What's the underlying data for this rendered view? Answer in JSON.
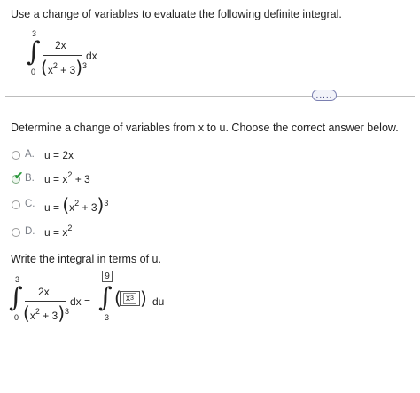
{
  "problem": {
    "instruction": "Use a change of variables to evaluate the following definite integral.",
    "integral": {
      "upper": "3",
      "lower": "0",
      "numerator": "2x",
      "denominator_base": "x",
      "denominator_inner_exp": "2",
      "denominator_plus": "+ 3",
      "denominator_outer_exp": "3",
      "differential": "dx"
    }
  },
  "more_button": {
    "label": "....."
  },
  "question1": {
    "prompt": "Determine a change of variables from x to u. Choose the correct answer below.",
    "options": [
      {
        "letter": "A.",
        "text": "u = 2x",
        "selected": false
      },
      {
        "letter": "B.",
        "text": "u = x² + 3",
        "selected": true
      },
      {
        "letter": "C.",
        "text": "u = (x² + 3)³",
        "selected": false
      },
      {
        "letter": "D.",
        "text": "u = x²",
        "selected": false
      }
    ],
    "option_b": {
      "lhs": "u = x",
      "exp": "2",
      "rest": "+ 3"
    },
    "option_c": {
      "lhs": "u =",
      "x": "x",
      "inner_exp": "2",
      "plus": "+ 3",
      "outer_exp": "3"
    },
    "option_d": {
      "lhs": "u = x",
      "exp": "2"
    }
  },
  "question2": {
    "prompt": "Write the integral in terms of u.",
    "lhs": {
      "upper": "3",
      "lower": "0",
      "numerator": "2x",
      "base": "x",
      "inner_exp": "2",
      "plus": "+ 3",
      "outer_exp": "3",
      "differential": "dx ="
    },
    "rhs": {
      "upper_input": "9",
      "lower": "3",
      "integrand_input": "x",
      "integrand_exp": "3",
      "differential": "du"
    }
  },
  "colors": {
    "check": "#2a9b3c",
    "divider": "#bdbdbd",
    "button_border": "#7a7fb0"
  }
}
